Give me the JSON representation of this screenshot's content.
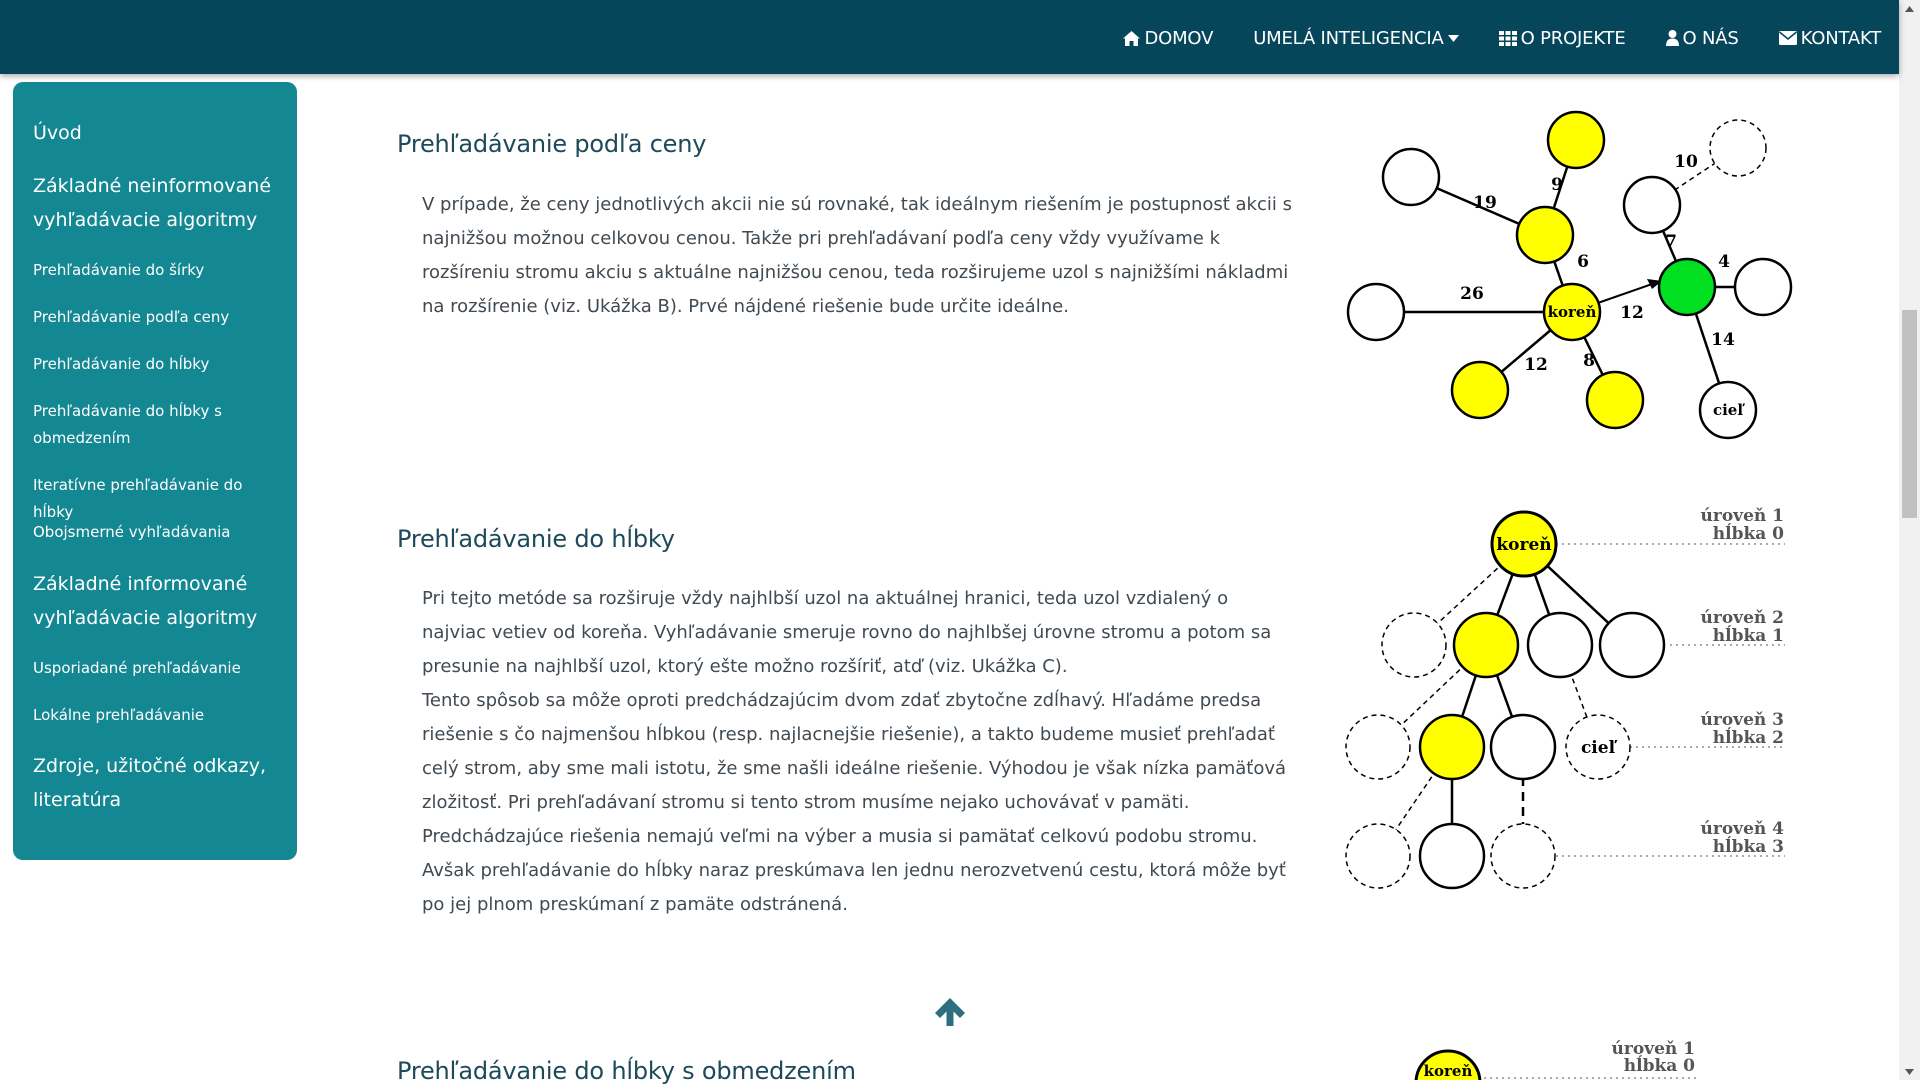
{
  "nav": {
    "items": [
      {
        "label": "DOMOV",
        "icon": "home-icon"
      },
      {
        "label": "UMELÁ INTELIGENCIA",
        "icon": "caret-down-icon"
      },
      {
        "label": "O PROJEKTE",
        "icon": "grid-icon"
      },
      {
        "label": "O NÁS",
        "icon": "user-icon"
      },
      {
        "label": "KONTAKT",
        "icon": "envelope-icon"
      }
    ]
  },
  "sidebar": {
    "items": [
      {
        "label": "Úvod"
      },
      {
        "label": "Základné neinformované vyhľadávacie algoritmy"
      },
      {
        "label": "Prehľadávanie do šírky"
      },
      {
        "label": "Prehľadávanie podľa ceny"
      },
      {
        "label": "Prehľadávanie do hĺbky"
      },
      {
        "label": "Prehľadávanie do hĺbky s obmedzením"
      },
      {
        "label": "Iteratívne prehľadávanie do hĺbky"
      },
      {
        "label": "Obojsmerné vyhľadávania"
      },
      {
        "label": "Základné informované vyhľadávacie algoritmy"
      },
      {
        "label": "Usporiadané prehľadávanie"
      },
      {
        "label": "Lokálne prehľadávanie"
      },
      {
        "label": "Zdroje, užitočné odkazy, literatúra"
      }
    ]
  },
  "sections": [
    {
      "title": "Prehľadávanie podľa ceny",
      "paragraphs": [
        "V prípade, že ceny jednotlivých akcii nie sú rovnaké, tak ideálnym riešením je postupnosť akcii s najnižšou možnou celkovou cenou. Takže pri prehľadávaní podľa ceny vždy využívame k rozšíreniu stromu akciu s aktuálne najnižšou cenou, teda rozširujeme uzol s najnižšími nákladmi na rozšírenie (viz. Ukážka B). Prvé nájdené riešenie bude určite ideálne."
      ],
      "diagram": {
        "root_label": "koreň",
        "goal_label": "cieľ",
        "edge_labels": [
          "10",
          "9",
          "19",
          "6",
          "7",
          "4",
          "26",
          "12",
          "14",
          "12",
          "8"
        ]
      }
    },
    {
      "title": "Prehľadávanie do hĺbky",
      "paragraphs": [
        "Pri tejto metóde sa rozširuje vždy najhlbší uzol na aktuálnej hranici, teda uzol vzdialený o najviac vetiev od koreňa. Vyhľadávanie smeruje rovno do najhlbšej úrovne stromu a potom sa presunie na najhlbší uzol, ktorý ešte možno rozšíriť, atď (viz. Ukážka C).",
        "Tento spôsob sa môže oproti predchádzajúcim dvom zdať zbytočne zdĺhavý. Hľadáme predsa riešenie s čo najmenšou hĺbkou (resp. najlacnejšie riešenie), a takto budeme musieť prehľadať celý strom, aby sme mali istotu, že sme našli ideálne riešenie. Výhodou je však nízka pamäťová zložitosť. Pri prehľadávaní stromu si tento strom musíme nejako uchovávať v pamäti. Predchádzajúce riešenia nemajú veľmi na výber a musia si pamätať celkovú podobu stromu. Avšak prehľadávanie do hĺbky naraz preskúmava len jednu nerozvetvenú cestu, ktorá môže byť po jej plnom preskúmaní z pamäte odstránená."
      ],
      "diagram": {
        "root_label": "koreň",
        "goal_label": "cieľ",
        "levels": [
          {
            "uroven": "úroveň 1",
            "hlbka": "hĺbka 0"
          },
          {
            "uroven": "úroveň 2",
            "hlbka": "hĺbka 1"
          },
          {
            "uroven": "úroveň 3",
            "hlbka": "hĺbka 2"
          },
          {
            "uroven": "úroveň 4",
            "hlbka": "hĺbka 3"
          }
        ]
      }
    },
    {
      "title": "Prehľadávanie do hĺbky s obmedzením",
      "diagram": {
        "root_label": "koreň",
        "levels": [
          {
            "uroven": "úroveň 1",
            "hlbka": "hĺbka 0"
          }
        ]
      }
    }
  ],
  "colors": {
    "navbar": "#06465b",
    "sidebar": "#138792",
    "node_yellow": "#ffff00",
    "node_green": "#00e020",
    "heading": "#1d4a5a"
  }
}
